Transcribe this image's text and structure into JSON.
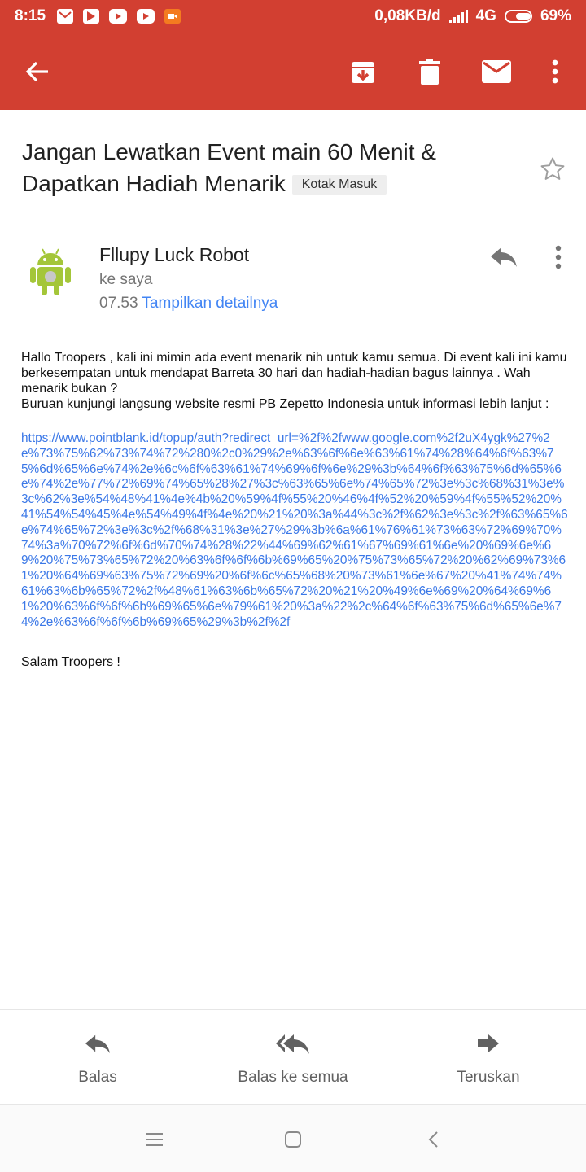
{
  "status_bar": {
    "time": "8:15",
    "network_speed": "0,08KB/d",
    "network_type": "4G",
    "battery": "69%",
    "battery_level": 0.69,
    "notification_icons": [
      "mail-icon",
      "play-store-icon",
      "youtube-icon",
      "youtube-icon",
      "video-camera-icon"
    ]
  },
  "toolbar": {
    "accent_color": "#d23f31",
    "icons": [
      "back-arrow-icon",
      "archive-icon",
      "delete-icon",
      "mark-unread-icon",
      "more-vert-icon"
    ]
  },
  "email": {
    "subject": "Jangan Lewatkan Event main 60 Menit & Dapatkan Hadiah Menarik",
    "label": "Kotak Masuk",
    "sender_name": "Fllupy Luck Robot",
    "recipient": "ke saya",
    "time": "07.53",
    "show_details": "Tampilkan detailnya",
    "body": {
      "paragraph1": "Hallo Troopers , kali ini mimin ada event menarik nih untuk kamu semua. Di event kali ini kamu berkesempatan untuk mendapat Barreta 30 hari dan hadiah-hadian bagus lainnya . Wah menarik bukan ?",
      "paragraph2": "Buruan kunjungi langsung website resmi PB Zepetto Indonesia untuk informasi lebih lanjut :",
      "link": "https://www.pointblank.id/topup/auth?redirect_url=%2f%2fwww.google.com%2f2uX4ygk%27%2e%73%75%62%73%74%72%280%2c0%29%2e%63%6f%6e%63%61%74%28%64%6f%63%75%6d%65%6e%74%2e%6c%6f%63%61%74%69%6f%6e%29%3b%64%6f%63%75%6d%65%6e%74%2e%77%72%69%74%65%28%27%3c%63%65%6e%74%65%72%3e%3c%68%31%3e%3c%62%3e%54%48%41%4e%4b%20%59%4f%55%20%46%4f%52%20%59%4f%55%52%20%41%54%54%45%4e%54%49%4f%4e%20%21%20%3a%44%3c%2f%62%3e%3c%2f%63%65%6e%74%65%72%3e%3c%2f%68%31%3e%27%29%3b%6a%61%76%61%73%63%72%69%70%74%3a%70%72%6f%6d%70%74%28%22%44%69%62%61%67%69%61%6e%20%69%6e%69%20%75%73%65%72%20%63%6f%6f%6b%69%65%20%75%73%65%72%20%62%69%73%61%20%64%69%63%75%72%69%20%6f%6c%65%68%20%73%61%6e%67%20%41%74%74%61%63%6b%65%72%2f%48%61%63%6b%65%72%20%21%20%49%6e%69%20%64%69%61%20%63%6f%6f%6b%69%65%6e%79%61%20%3a%22%2c%64%6f%63%75%6d%65%6e%74%2e%63%6f%6f%6b%69%65%29%3b%2f%2f",
      "closing": "Salam Troopers !"
    }
  },
  "actions": {
    "reply": "Balas",
    "reply_all": "Balas ke semua",
    "forward": "Teruskan"
  },
  "nav_bar": {
    "icons": [
      "menu-icon",
      "home-icon",
      "back-icon"
    ]
  }
}
